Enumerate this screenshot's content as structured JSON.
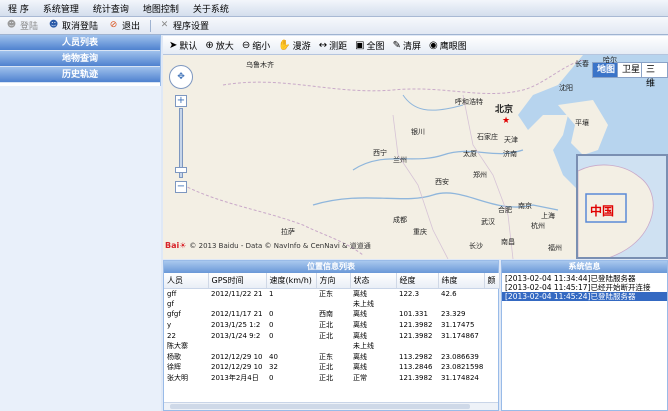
{
  "menu": [
    "程 序",
    "系统管理",
    "统计查询",
    "地图控制",
    "关于系统"
  ],
  "toolbar": {
    "login": "登陆",
    "cancel_login": "取消登陆",
    "logout": "退出",
    "settings": "程序设置"
  },
  "sidebar": {
    "items": [
      "人员列表",
      "地物查询",
      "历史轨迹"
    ]
  },
  "map_tools": [
    "默认",
    "放大",
    "缩小",
    "漫游",
    "测距",
    "全图",
    "清屏",
    "鹰眼图"
  ],
  "map": {
    "types": [
      "地图",
      "卫星",
      "三维"
    ],
    "cities": [
      {
        "name": "乌鲁木齐"
      },
      {
        "name": "北京"
      },
      {
        "name": "天津"
      },
      {
        "name": "呼和浩特"
      },
      {
        "name": "银川"
      },
      {
        "name": "石家庄"
      },
      {
        "name": "太原"
      },
      {
        "name": "济南"
      },
      {
        "name": "西宁"
      },
      {
        "name": "兰州"
      },
      {
        "name": "郑州"
      },
      {
        "name": "西安"
      },
      {
        "name": "南京"
      },
      {
        "name": "上海"
      },
      {
        "name": "合肥"
      },
      {
        "name": "武汉"
      },
      {
        "name": "杭州"
      },
      {
        "name": "成都"
      },
      {
        "name": "重庆"
      },
      {
        "name": "长沙"
      },
      {
        "name": "南昌"
      },
      {
        "name": "福州"
      },
      {
        "name": "拉萨"
      },
      {
        "name": "沈阳"
      },
      {
        "name": "长春"
      },
      {
        "name": "哈尔"
      },
      {
        "name": "平壤"
      }
    ],
    "inset_label": "中国",
    "copyright": "© 2013 Baidu - Data © NavInfo & CenNavi & 道道通"
  },
  "gps": {
    "title": "位置信息列表",
    "columns": [
      "人员",
      "GPS时间",
      "速度(km/h)",
      "方向",
      "状态",
      "经度",
      "纬度",
      "颜"
    ],
    "rows": [
      [
        "gff",
        "2012/11/22 21",
        "1",
        "正东",
        "离线",
        "122.3",
        "42.6"
      ],
      [
        "gf",
        "",
        "",
        "",
        "未上线",
        "",
        ""
      ],
      [
        "gfgf",
        "2012/11/17 21",
        "0",
        "西南",
        "离线",
        "101.331",
        "23.329"
      ],
      [
        "y",
        "2013/1/25 1:2",
        "0",
        "正北",
        "离线",
        "121.3982",
        "31.17475"
      ],
      [
        "22",
        "2013/1/24 9:2",
        "0",
        "正北",
        "离线",
        "121.3982",
        "31.174867"
      ],
      [
        "陈大寨",
        "",
        "",
        "",
        "未上线",
        "",
        ""
      ],
      [
        "杨歌",
        "2012/12/29 10",
        "40",
        "正东",
        "离线",
        "113.2982",
        "23.086639"
      ],
      [
        "徐辉",
        "2012/12/29 10",
        "32",
        "正北",
        "离线",
        "113.2846",
        "23.08215981"
      ],
      [
        "张大明",
        "2013年2月4日",
        "0",
        "正北",
        "正常",
        "121.3982",
        "31.174824"
      ]
    ]
  },
  "system": {
    "title": "系统信息",
    "messages": [
      "[2013-02-04 11:34:44]已登陆服务器",
      "[2013-02-04 11:45:17]已经开始断开连接",
      "[2013-02-04 11:45:24]已登陆服务器"
    ]
  },
  "colors": {
    "accent": "#4f82cf",
    "selected": "#3469c2"
  }
}
